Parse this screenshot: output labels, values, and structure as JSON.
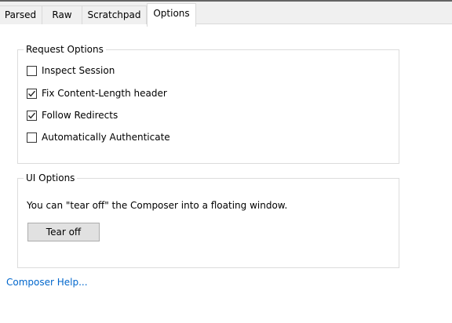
{
  "tabs": [
    {
      "label": "Parsed",
      "active": false
    },
    {
      "label": "Raw",
      "active": false
    },
    {
      "label": "Scratchpad",
      "active": false
    },
    {
      "label": "Options",
      "active": true
    }
  ],
  "request_options": {
    "title": "Request Options",
    "items": [
      {
        "label": "Inspect Session",
        "checked": false
      },
      {
        "label": "Fix Content-Length header",
        "checked": true
      },
      {
        "label": "Follow Redirects",
        "checked": true
      },
      {
        "label": "Automatically Authenticate",
        "checked": false
      }
    ]
  },
  "ui_options": {
    "title": "UI Options",
    "description": "You can \"tear off\" the Composer into a floating window.",
    "button_label": "Tear off"
  },
  "help_link": "Composer Help...",
  "colors": {
    "link": "#0066cc",
    "button_bg": "#e1e1e1",
    "tab_bg": "#f0f0f0"
  }
}
